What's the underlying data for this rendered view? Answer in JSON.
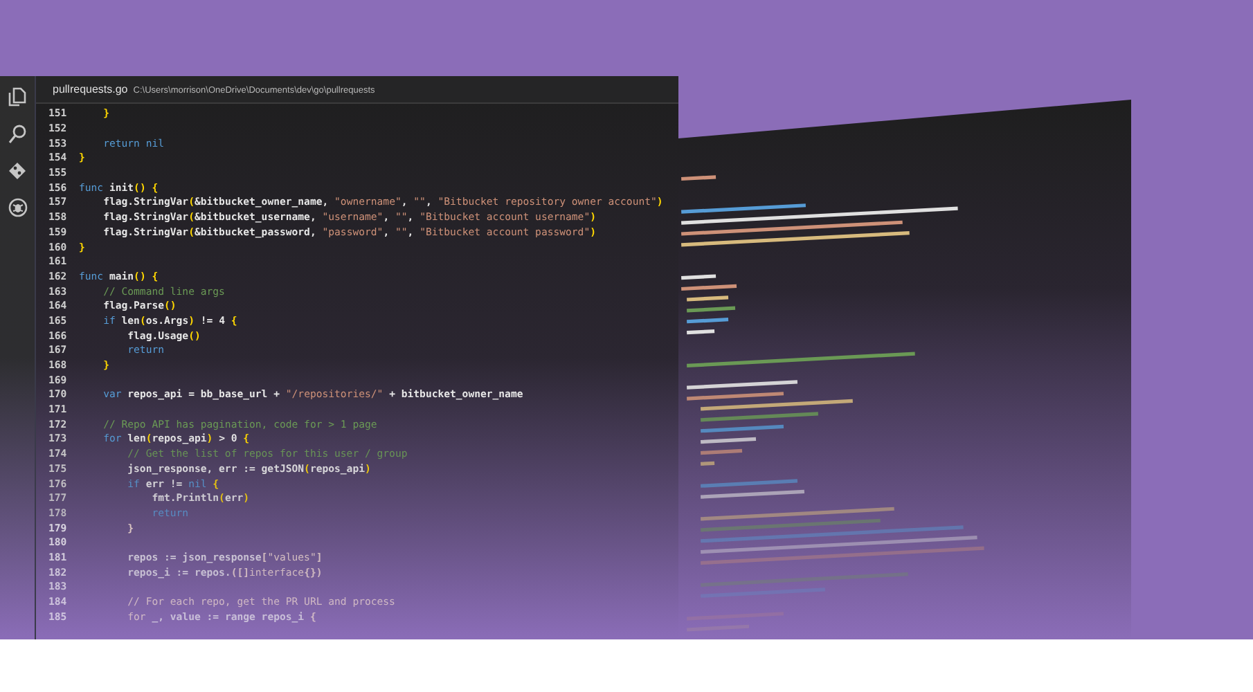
{
  "activity_bar": {
    "items": [
      {
        "kind": "files"
      },
      {
        "kind": "search"
      },
      {
        "kind": "git"
      },
      {
        "kind": "debug"
      }
    ]
  },
  "editor": {
    "filename": "pullrequests.go",
    "path": "C:\\Users\\morrison\\OneDrive\\Documents\\dev\\go\\pullrequests",
    "lines": [
      {
        "number": "151",
        "tokens": [
          {
            "kind": "punct",
            "text": "    }"
          }
        ]
      },
      {
        "number": "152"
      },
      {
        "number": "153",
        "tokens": [
          {
            "kind": "keyword",
            "text": "    return nil"
          }
        ]
      },
      {
        "number": "154",
        "tokens": [
          {
            "kind": "punct",
            "text": "}"
          }
        ]
      },
      {
        "number": "155"
      },
      {
        "number": "156",
        "tokens": [
          {
            "kind": "keyword",
            "text": "func"
          },
          {
            "kind": "text",
            "text": " init"
          },
          {
            "kind": "punct",
            "text": "() {"
          }
        ]
      },
      {
        "number": "157",
        "tokens": [
          {
            "kind": "text",
            "text": "    flag.StringVar"
          },
          {
            "kind": "punct",
            "text": "("
          },
          {
            "kind": "text",
            "text": "&bitbucket_owner_name, "
          },
          {
            "kind": "string",
            "text": "\"ownername\""
          },
          {
            "kind": "text",
            "text": ", "
          },
          {
            "kind": "string",
            "text": "\"\""
          },
          {
            "kind": "text",
            "text": ", "
          },
          {
            "kind": "string",
            "text": "\"Bitbucket repository owner account\""
          },
          {
            "kind": "punct",
            "text": ")"
          }
        ]
      },
      {
        "number": "158",
        "tokens": [
          {
            "kind": "text",
            "text": "    flag.StringVar"
          },
          {
            "kind": "punct",
            "text": "("
          },
          {
            "kind": "text",
            "text": "&bitbucket_username, "
          },
          {
            "kind": "string",
            "text": "\"username\""
          },
          {
            "kind": "text",
            "text": ", "
          },
          {
            "kind": "string",
            "text": "\"\""
          },
          {
            "kind": "text",
            "text": ", "
          },
          {
            "kind": "string",
            "text": "\"Bitbucket account username\""
          },
          {
            "kind": "punct",
            "text": ")"
          }
        ]
      },
      {
        "number": "159",
        "tokens": [
          {
            "kind": "text",
            "text": "    flag.StringVar"
          },
          {
            "kind": "punct",
            "text": "("
          },
          {
            "kind": "text",
            "text": "&bitbucket_password, "
          },
          {
            "kind": "string",
            "text": "\"password\""
          },
          {
            "kind": "text",
            "text": ", "
          },
          {
            "kind": "string",
            "text": "\"\""
          },
          {
            "kind": "text",
            "text": ", "
          },
          {
            "kind": "string",
            "text": "\"Bitbucket account password\""
          },
          {
            "kind": "punct",
            "text": ")"
          }
        ]
      },
      {
        "number": "160",
        "tokens": [
          {
            "kind": "punct",
            "text": "}"
          }
        ]
      },
      {
        "number": "161"
      },
      {
        "number": "162",
        "tokens": [
          {
            "kind": "keyword",
            "text": "func"
          },
          {
            "kind": "text",
            "text": " main"
          },
          {
            "kind": "punct",
            "text": "() {"
          }
        ]
      },
      {
        "number": "163",
        "tokens": [
          {
            "kind": "comment",
            "text": "    // Command line args"
          }
        ]
      },
      {
        "number": "164",
        "tokens": [
          {
            "kind": "text",
            "text": "    flag.Parse"
          },
          {
            "kind": "punct",
            "text": "()"
          }
        ]
      },
      {
        "number": "165",
        "tokens": [
          {
            "kind": "keyword",
            "text": "    if"
          },
          {
            "kind": "text",
            "text": " len"
          },
          {
            "kind": "punct",
            "text": "("
          },
          {
            "kind": "text",
            "text": "os.Args"
          },
          {
            "kind": "punct",
            "text": ")"
          },
          {
            "kind": "text",
            "text": " != 4"
          },
          {
            "kind": "punct",
            "text": " {"
          }
        ]
      },
      {
        "number": "166",
        "tokens": [
          {
            "kind": "text",
            "text": "        flag.Usage"
          },
          {
            "kind": "punct",
            "text": "()"
          }
        ]
      },
      {
        "number": "167",
        "tokens": [
          {
            "kind": "keyword",
            "text": "        return"
          }
        ]
      },
      {
        "number": "168",
        "tokens": [
          {
            "kind": "punct",
            "text": "    }"
          }
        ]
      },
      {
        "number": "169"
      },
      {
        "number": "170",
        "tokens": [
          {
            "kind": "keyword",
            "text": "    var"
          },
          {
            "kind": "text",
            "text": " repos_api = bb_base_url + "
          },
          {
            "kind": "string",
            "text": "\"/repositories/\""
          },
          {
            "kind": "text",
            "text": " + bitbucket_owner_name"
          }
        ]
      },
      {
        "number": "171"
      },
      {
        "number": "172",
        "tokens": [
          {
            "kind": "comment",
            "text": "    // Repo API has pagination, code for > 1 page"
          }
        ]
      },
      {
        "number": "173",
        "tokens": [
          {
            "kind": "keyword",
            "text": "    for"
          },
          {
            "kind": "text",
            "text": " len"
          },
          {
            "kind": "punct",
            "text": "("
          },
          {
            "kind": "text",
            "text": "repos_api"
          },
          {
            "kind": "punct",
            "text": ")"
          },
          {
            "kind": "text",
            "text": " > 0"
          },
          {
            "kind": "punct",
            "text": " {"
          }
        ]
      },
      {
        "number": "174",
        "tokens": [
          {
            "kind": "comment",
            "text": "        // Get the list of repos for this user / group"
          }
        ]
      },
      {
        "number": "175",
        "tokens": [
          {
            "kind": "text",
            "text": "        json_response, err := getJSON"
          },
          {
            "kind": "punct",
            "text": "("
          },
          {
            "kind": "text",
            "text": "repos_api"
          },
          {
            "kind": "punct",
            "text": ")"
          }
        ]
      },
      {
        "number": "176",
        "tokens": [
          {
            "kind": "keyword",
            "text": "        if"
          },
          {
            "kind": "text",
            "text": " err != "
          },
          {
            "kind": "keyword",
            "text": "nil"
          },
          {
            "kind": "punct",
            "text": " {"
          }
        ]
      },
      {
        "number": "177",
        "tokens": [
          {
            "kind": "text",
            "text": "            fmt.Println"
          },
          {
            "kind": "punct",
            "text": "("
          },
          {
            "kind": "text",
            "text": "err"
          },
          {
            "kind": "punct",
            "text": ")"
          }
        ]
      },
      {
        "number": "178",
        "tokens": [
          {
            "kind": "keyword",
            "text": "            return"
          }
        ]
      },
      {
        "number": "179",
        "tokens": [
          {
            "kind": "punct",
            "text": "        }"
          }
        ]
      },
      {
        "number": "180"
      },
      {
        "number": "181",
        "tokens": [
          {
            "kind": "text",
            "text": "        repos := json_response"
          },
          {
            "kind": "punct",
            "text": "["
          },
          {
            "kind": "string",
            "text": "\"values\""
          },
          {
            "kind": "punct",
            "text": "]"
          }
        ]
      },
      {
        "number": "182",
        "tokens": [
          {
            "kind": "text",
            "text": "        repos_i := repos."
          },
          {
            "kind": "punct",
            "text": "([]"
          },
          {
            "kind": "keyword",
            "text": "interface"
          },
          {
            "kind": "punct",
            "text": "{})"
          }
        ]
      },
      {
        "number": "183"
      },
      {
        "number": "184",
        "tokens": [
          {
            "kind": "comment",
            "text": "        // For each repo, get the PR URL and process"
          }
        ]
      },
      {
        "number": "185",
        "tokens": [
          {
            "kind": "keyword",
            "text": "        for"
          },
          {
            "kind": "text",
            "text": " _, value := range repos_i"
          },
          {
            "kind": "punct",
            "text": " {"
          }
        ]
      }
    ]
  }
}
